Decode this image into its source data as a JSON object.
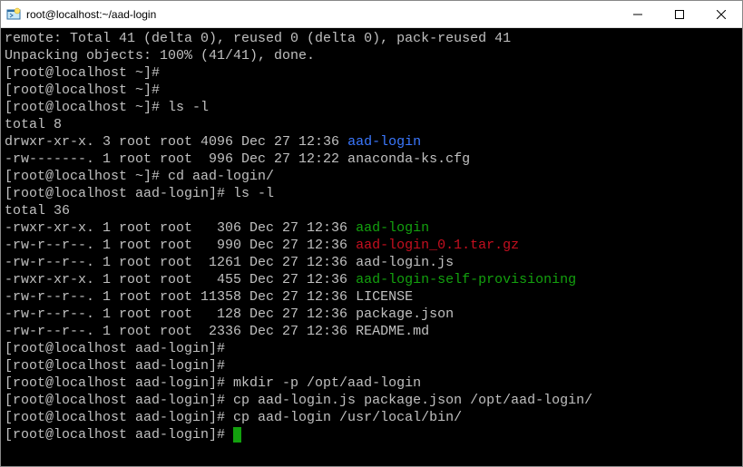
{
  "window": {
    "title": "root@localhost:~/aad-login"
  },
  "lines": [
    {
      "segments": [
        {
          "text": "remote: Total 41 (delta 0), reused 0 (delta 0), pack-reused 41"
        }
      ]
    },
    {
      "segments": [
        {
          "text": "Unpacking objects: 100% (41/41), done."
        }
      ]
    },
    {
      "segments": [
        {
          "text": "[root@localhost ~]#"
        }
      ]
    },
    {
      "segments": [
        {
          "text": "[root@localhost ~]#"
        }
      ]
    },
    {
      "segments": [
        {
          "text": "[root@localhost ~]# ls -l"
        }
      ]
    },
    {
      "segments": [
        {
          "text": "total 8"
        }
      ]
    },
    {
      "segments": [
        {
          "text": "drwxr-xr-x. 3 root root 4096 Dec 27 12:36 "
        },
        {
          "text": "aad-login",
          "cls": "blue"
        }
      ]
    },
    {
      "segments": [
        {
          "text": "-rw-------. 1 root root  996 Dec 27 12:22 anaconda-ks.cfg"
        }
      ]
    },
    {
      "segments": [
        {
          "text": "[root@localhost ~]# cd aad-login/"
        }
      ]
    },
    {
      "segments": [
        {
          "text": "[root@localhost aad-login]# ls -l"
        }
      ]
    },
    {
      "segments": [
        {
          "text": "total 36"
        }
      ]
    },
    {
      "segments": [
        {
          "text": "-rwxr-xr-x. 1 root root   306 Dec 27 12:36 "
        },
        {
          "text": "aad-login",
          "cls": "green"
        }
      ]
    },
    {
      "segments": [
        {
          "text": "-rw-r--r--. 1 root root   990 Dec 27 12:36 "
        },
        {
          "text": "aad-login_0.1.tar.gz",
          "cls": "red"
        }
      ]
    },
    {
      "segments": [
        {
          "text": "-rw-r--r--. 1 root root  1261 Dec 27 12:36 aad-login.js"
        }
      ]
    },
    {
      "segments": [
        {
          "text": "-rwxr-xr-x. 1 root root   455 Dec 27 12:36 "
        },
        {
          "text": "aad-login-self-provisioning",
          "cls": "green"
        }
      ]
    },
    {
      "segments": [
        {
          "text": "-rw-r--r--. 1 root root 11358 Dec 27 12:36 LICENSE"
        }
      ]
    },
    {
      "segments": [
        {
          "text": "-rw-r--r--. 1 root root   128 Dec 27 12:36 package.json"
        }
      ]
    },
    {
      "segments": [
        {
          "text": "-rw-r--r--. 1 root root  2336 Dec 27 12:36 README.md"
        }
      ]
    },
    {
      "segments": [
        {
          "text": "[root@localhost aad-login]#"
        }
      ]
    },
    {
      "segments": [
        {
          "text": "[root@localhost aad-login]#"
        }
      ]
    },
    {
      "segments": [
        {
          "text": "[root@localhost aad-login]# mkdir -p /opt/aad-login"
        }
      ]
    },
    {
      "segments": [
        {
          "text": "[root@localhost aad-login]# cp aad-login.js package.json /opt/aad-login/"
        }
      ]
    },
    {
      "segments": [
        {
          "text": "[root@localhost aad-login]# cp aad-login /usr/local/bin/"
        }
      ]
    },
    {
      "segments": [
        {
          "text": "[root@localhost aad-login]# "
        }
      ],
      "cursor": true
    }
  ]
}
